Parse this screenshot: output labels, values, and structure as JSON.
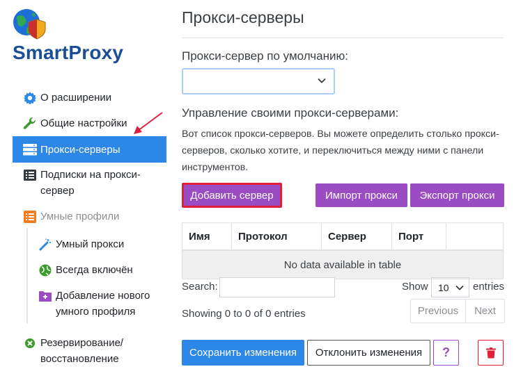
{
  "app": {
    "brand": "SmartProxy"
  },
  "sidebar": {
    "items": [
      {
        "label": "О расширении",
        "icon": "gear-icon"
      },
      {
        "label": "Общие настройки",
        "icon": "wrench-icon"
      },
      {
        "label": "Прокси-серверы",
        "icon": "server-icon",
        "active": true
      },
      {
        "label": "Подписки на прокси-сервер",
        "icon": "list-icon"
      },
      {
        "label": "Умные профили",
        "icon": "profiles-icon"
      },
      {
        "label": "Резервирование/восстановление",
        "icon": "backup-icon"
      }
    ],
    "subitems": [
      {
        "label": "Умный прокси",
        "icon": "magic-wand-icon"
      },
      {
        "label": "Всегда включён",
        "icon": "globe-icon"
      },
      {
        "label": "Добавление нового умного профиля",
        "icon": "folder-plus-icon"
      }
    ]
  },
  "main": {
    "title": "Прокси-серверы",
    "default_proxy_label": "Прокси-сервер по умолчанию:",
    "default_proxy_value": "",
    "manage_label": "Управление своими прокси-серверами:",
    "description": "Вот список прокси-серверов. Вы можете определить столько прокси-серверов, сколько хотите, и переключиться между ними с панели инструментов.",
    "buttons": {
      "add": "Добавить сервер",
      "import": "Импорт прокси",
      "export": "Экспорт прокси"
    },
    "table": {
      "columns": [
        "Имя",
        "Протокол",
        "Сервер",
        "Порт",
        ""
      ],
      "empty_message": "No data available in table"
    },
    "search_label": "Search:",
    "search_value": "",
    "show_label": "Show",
    "page_length": "10",
    "entries_label": "entries",
    "info": "Showing 0 to 0 of 0 entries",
    "pager": {
      "previous": "Previous",
      "next": "Next"
    },
    "footer": {
      "save": "Сохранить изменения",
      "discard": "Отклонить изменения",
      "help": "?"
    }
  },
  "colors": {
    "brand": "#1c4e97",
    "active_nav": "#2d87e6",
    "purple_button": "#9b4cc2",
    "danger": "#e0203a"
  }
}
